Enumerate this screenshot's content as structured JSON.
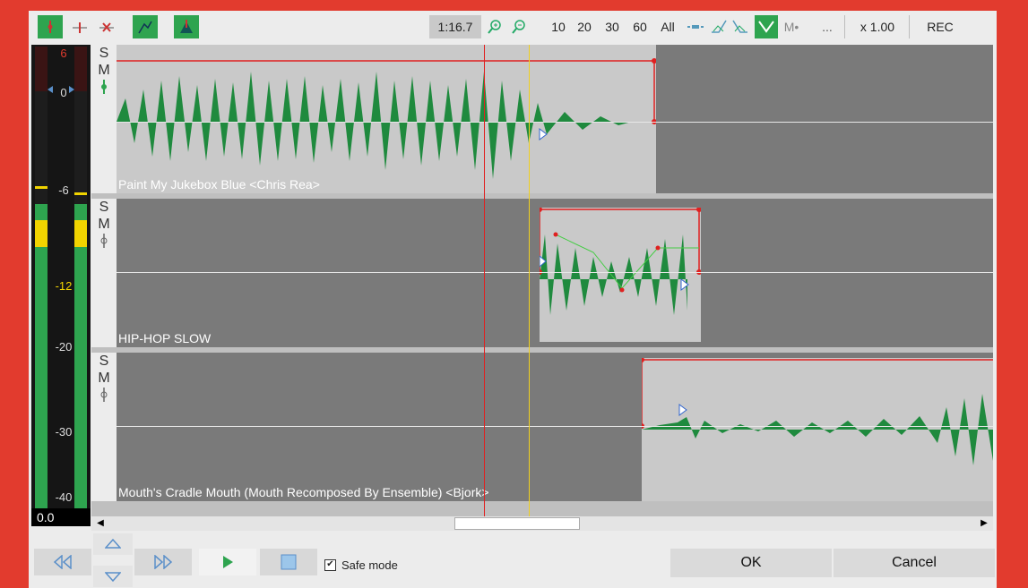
{
  "toolbar": {
    "time": "1:16.7",
    "zoom_levels": [
      "10",
      "20",
      "30",
      "60",
      "All"
    ],
    "m_label": "M•",
    "ellipsis": "...",
    "speed": "x 1.00",
    "rec": "REC"
  },
  "meter": {
    "labels": [
      "6",
      "0",
      "-6",
      "-12",
      "-20",
      "-30",
      "-40"
    ],
    "value": "0.0",
    "level_left": 0.34,
    "level_right": 0.34
  },
  "tracks": [
    {
      "solo": "S",
      "mute": "M",
      "name": "Paint My Jukebox Blue <Chris Rea>"
    },
    {
      "solo": "S",
      "mute": "M",
      "name": "HIP-HOP SLOW"
    },
    {
      "solo": "S",
      "mute": "M",
      "name": "Mouth's Cradle Mouth (Mouth Recomposed By Ensemble)  <Bjork>"
    }
  ],
  "bottom": {
    "safe_mode_label": "Safe mode",
    "safe_mode_checked": true,
    "ok_label": "OK",
    "cancel_label": "Cancel"
  },
  "colors": {
    "accent_green": "#2ea44f",
    "wave_green": "#1f8a3e",
    "envelope_red": "#e02020",
    "cursor_yellow": "#f0d020",
    "frame_red": "#e23b2e"
  }
}
